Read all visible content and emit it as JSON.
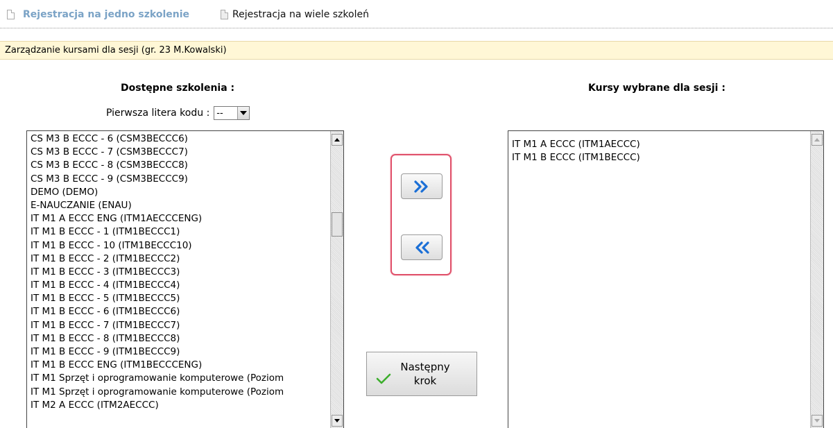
{
  "tabs": {
    "active_label": "Rejestracja na jedno szkolenie",
    "other_label": "Rejestracja na wiele szkoleń"
  },
  "session": {
    "title": "Zarządzanie kursami dla sesji (gr. 23 M.Kowalski)"
  },
  "available": {
    "heading": "Dostępne szkolenia :",
    "filter_label": "Pierwsza litera kodu :",
    "filter_value": "--",
    "items": [
      "CS M3 B ECCC - 6 (CSM3BECCC6)",
      "CS M3 B ECCC - 7 (CSM3BECCC7)",
      "CS M3 B ECCC - 8 (CSM3BECCC8)",
      "CS M3 B ECCC - 9 (CSM3BECCC9)",
      "DEMO (DEMO)",
      "E-NAUCZANIE (ENAU)",
      "IT M1 A ECCC ENG (ITM1AECCCENG)",
      "IT M1 B ECCC - 1 (ITM1BECCC1)",
      "IT M1 B ECCC - 10 (ITM1BECCC10)",
      "IT M1 B ECCC - 2 (ITM1BECCC2)",
      "IT M1 B ECCC - 3 (ITM1BECCC3)",
      "IT M1 B ECCC - 4 (ITM1BECCC4)",
      "IT M1 B ECCC - 5 (ITM1BECCC5)",
      "IT M1 B ECCC - 6 (ITM1BECCC6)",
      "IT M1 B ECCC - 7 (ITM1BECCC7)",
      "IT M1 B ECCC - 8 (ITM1BECCC8)",
      "IT M1 B ECCC - 9 (ITM1BECCC9)",
      "IT M1 B ECCC ENG (ITM1BECCCENG)",
      "IT M1 Sprzęt i oprogramowanie komputerowe (Poziom",
      "IT M1 Sprzęt i oprogramowanie komputerowe (Poziom",
      "IT M2 A ECCC (ITM2AECCC)"
    ]
  },
  "selected": {
    "heading": "Kursy wybrane dla sesji :",
    "items": [
      "IT M1 A ECCC (ITM1AECCC)",
      "IT M1 B ECCC (ITM1BECCC)"
    ]
  },
  "actions": {
    "add_icon": "double-chevron-right-icon",
    "remove_icon": "double-chevron-left-icon",
    "next_label": "Następny\nkrok",
    "next_icon": "checkmark-icon"
  },
  "colors": {
    "active_tab": "#7ba3c6",
    "session_bar_bg": "#fff7d6",
    "move_group_outline": "#e0506a",
    "chevron_blue": "#1b6fd6",
    "check_green": "#3cae2c"
  }
}
